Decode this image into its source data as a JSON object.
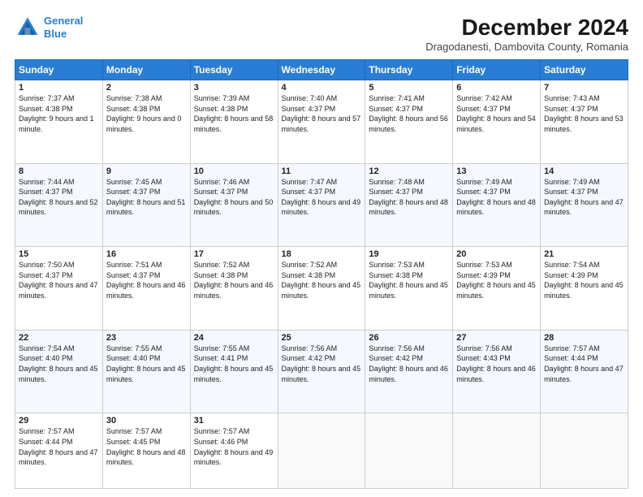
{
  "header": {
    "logo_line1": "General",
    "logo_line2": "Blue",
    "main_title": "December 2024",
    "subtitle": "Dragodanesti, Dambovita County, Romania"
  },
  "days_of_week": [
    "Sunday",
    "Monday",
    "Tuesday",
    "Wednesday",
    "Thursday",
    "Friday",
    "Saturday"
  ],
  "weeks": [
    [
      {
        "day": "1",
        "sunrise": "Sunrise: 7:37 AM",
        "sunset": "Sunset: 4:38 PM",
        "daylight": "Daylight: 9 hours and 1 minute."
      },
      {
        "day": "2",
        "sunrise": "Sunrise: 7:38 AM",
        "sunset": "Sunset: 4:38 PM",
        "daylight": "Daylight: 9 hours and 0 minutes."
      },
      {
        "day": "3",
        "sunrise": "Sunrise: 7:39 AM",
        "sunset": "Sunset: 4:38 PM",
        "daylight": "Daylight: 8 hours and 58 minutes."
      },
      {
        "day": "4",
        "sunrise": "Sunrise: 7:40 AM",
        "sunset": "Sunset: 4:37 PM",
        "daylight": "Daylight: 8 hours and 57 minutes."
      },
      {
        "day": "5",
        "sunrise": "Sunrise: 7:41 AM",
        "sunset": "Sunset: 4:37 PM",
        "daylight": "Daylight: 8 hours and 56 minutes."
      },
      {
        "day": "6",
        "sunrise": "Sunrise: 7:42 AM",
        "sunset": "Sunset: 4:37 PM",
        "daylight": "Daylight: 8 hours and 54 minutes."
      },
      {
        "day": "7",
        "sunrise": "Sunrise: 7:43 AM",
        "sunset": "Sunset: 4:37 PM",
        "daylight": "Daylight: 8 hours and 53 minutes."
      }
    ],
    [
      {
        "day": "8",
        "sunrise": "Sunrise: 7:44 AM",
        "sunset": "Sunset: 4:37 PM",
        "daylight": "Daylight: 8 hours and 52 minutes."
      },
      {
        "day": "9",
        "sunrise": "Sunrise: 7:45 AM",
        "sunset": "Sunset: 4:37 PM",
        "daylight": "Daylight: 8 hours and 51 minutes."
      },
      {
        "day": "10",
        "sunrise": "Sunrise: 7:46 AM",
        "sunset": "Sunset: 4:37 PM",
        "daylight": "Daylight: 8 hours and 50 minutes."
      },
      {
        "day": "11",
        "sunrise": "Sunrise: 7:47 AM",
        "sunset": "Sunset: 4:37 PM",
        "daylight": "Daylight: 8 hours and 49 minutes."
      },
      {
        "day": "12",
        "sunrise": "Sunrise: 7:48 AM",
        "sunset": "Sunset: 4:37 PM",
        "daylight": "Daylight: 8 hours and 48 minutes."
      },
      {
        "day": "13",
        "sunrise": "Sunrise: 7:49 AM",
        "sunset": "Sunset: 4:37 PM",
        "daylight": "Daylight: 8 hours and 48 minutes."
      },
      {
        "day": "14",
        "sunrise": "Sunrise: 7:49 AM",
        "sunset": "Sunset: 4:37 PM",
        "daylight": "Daylight: 8 hours and 47 minutes."
      }
    ],
    [
      {
        "day": "15",
        "sunrise": "Sunrise: 7:50 AM",
        "sunset": "Sunset: 4:37 PM",
        "daylight": "Daylight: 8 hours and 47 minutes."
      },
      {
        "day": "16",
        "sunrise": "Sunrise: 7:51 AM",
        "sunset": "Sunset: 4:37 PM",
        "daylight": "Daylight: 8 hours and 46 minutes."
      },
      {
        "day": "17",
        "sunrise": "Sunrise: 7:52 AM",
        "sunset": "Sunset: 4:38 PM",
        "daylight": "Daylight: 8 hours and 46 minutes."
      },
      {
        "day": "18",
        "sunrise": "Sunrise: 7:52 AM",
        "sunset": "Sunset: 4:38 PM",
        "daylight": "Daylight: 8 hours and 45 minutes."
      },
      {
        "day": "19",
        "sunrise": "Sunrise: 7:53 AM",
        "sunset": "Sunset: 4:38 PM",
        "daylight": "Daylight: 8 hours and 45 minutes."
      },
      {
        "day": "20",
        "sunrise": "Sunrise: 7:53 AM",
        "sunset": "Sunset: 4:39 PM",
        "daylight": "Daylight: 8 hours and 45 minutes."
      },
      {
        "day": "21",
        "sunrise": "Sunrise: 7:54 AM",
        "sunset": "Sunset: 4:39 PM",
        "daylight": "Daylight: 8 hours and 45 minutes."
      }
    ],
    [
      {
        "day": "22",
        "sunrise": "Sunrise: 7:54 AM",
        "sunset": "Sunset: 4:40 PM",
        "daylight": "Daylight: 8 hours and 45 minutes."
      },
      {
        "day": "23",
        "sunrise": "Sunrise: 7:55 AM",
        "sunset": "Sunset: 4:40 PM",
        "daylight": "Daylight: 8 hours and 45 minutes."
      },
      {
        "day": "24",
        "sunrise": "Sunrise: 7:55 AM",
        "sunset": "Sunset: 4:41 PM",
        "daylight": "Daylight: 8 hours and 45 minutes."
      },
      {
        "day": "25",
        "sunrise": "Sunrise: 7:56 AM",
        "sunset": "Sunset: 4:42 PM",
        "daylight": "Daylight: 8 hours and 45 minutes."
      },
      {
        "day": "26",
        "sunrise": "Sunrise: 7:56 AM",
        "sunset": "Sunset: 4:42 PM",
        "daylight": "Daylight: 8 hours and 46 minutes."
      },
      {
        "day": "27",
        "sunrise": "Sunrise: 7:56 AM",
        "sunset": "Sunset: 4:43 PM",
        "daylight": "Daylight: 8 hours and 46 minutes."
      },
      {
        "day": "28",
        "sunrise": "Sunrise: 7:57 AM",
        "sunset": "Sunset: 4:44 PM",
        "daylight": "Daylight: 8 hours and 47 minutes."
      }
    ],
    [
      {
        "day": "29",
        "sunrise": "Sunrise: 7:57 AM",
        "sunset": "Sunset: 4:44 PM",
        "daylight": "Daylight: 8 hours and 47 minutes."
      },
      {
        "day": "30",
        "sunrise": "Sunrise: 7:57 AM",
        "sunset": "Sunset: 4:45 PM",
        "daylight": "Daylight: 8 hours and 48 minutes."
      },
      {
        "day": "31",
        "sunrise": "Sunrise: 7:57 AM",
        "sunset": "Sunset: 4:46 PM",
        "daylight": "Daylight: 8 hours and 49 minutes."
      },
      null,
      null,
      null,
      null
    ]
  ]
}
